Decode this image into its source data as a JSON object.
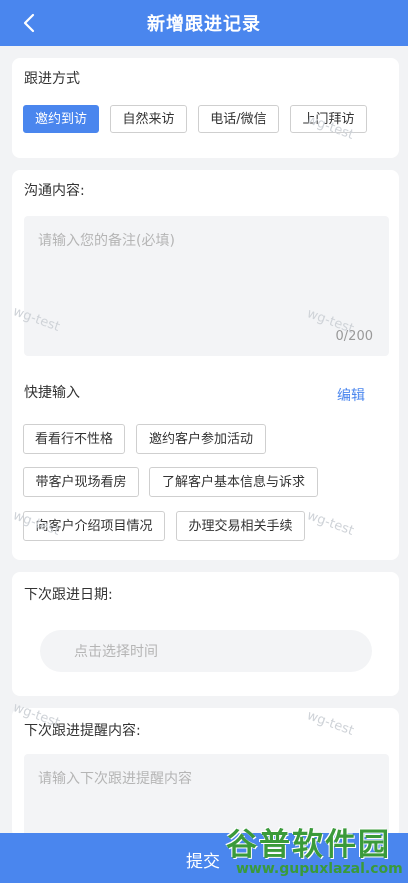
{
  "header": {
    "title": "新增跟进记录"
  },
  "method": {
    "label": "跟进方式",
    "options": [
      "邀约到访",
      "自然来访",
      "电话/微信",
      "上门拜访"
    ],
    "selected": "邀约到访"
  },
  "communication": {
    "label": "沟通内容:",
    "placeholder": "请输入您的备注(必填)",
    "counter": "0/200"
  },
  "quick": {
    "label": "快捷输入",
    "edit": "编辑",
    "chips": [
      "看看行不性格",
      "邀约客户参加活动",
      "带客户现场看房",
      "了解客户基本信息与诉求",
      "向客户介绍项目情况",
      "办理交易相关手续"
    ]
  },
  "next_date": {
    "label": "下次跟进日期:",
    "placeholder": "点击选择时间"
  },
  "reminder": {
    "label": "下次跟进提醒内容:",
    "placeholder": "请输入下次跟进提醒内容"
  },
  "watermark": "wg-test",
  "submit": {
    "label": "提交"
  },
  "logo": {
    "name": "谷普软件园",
    "url": "www.gupuxlazal.com"
  },
  "colors": {
    "primary": "#4a86ee",
    "logo_green": "#3a9a3a"
  }
}
